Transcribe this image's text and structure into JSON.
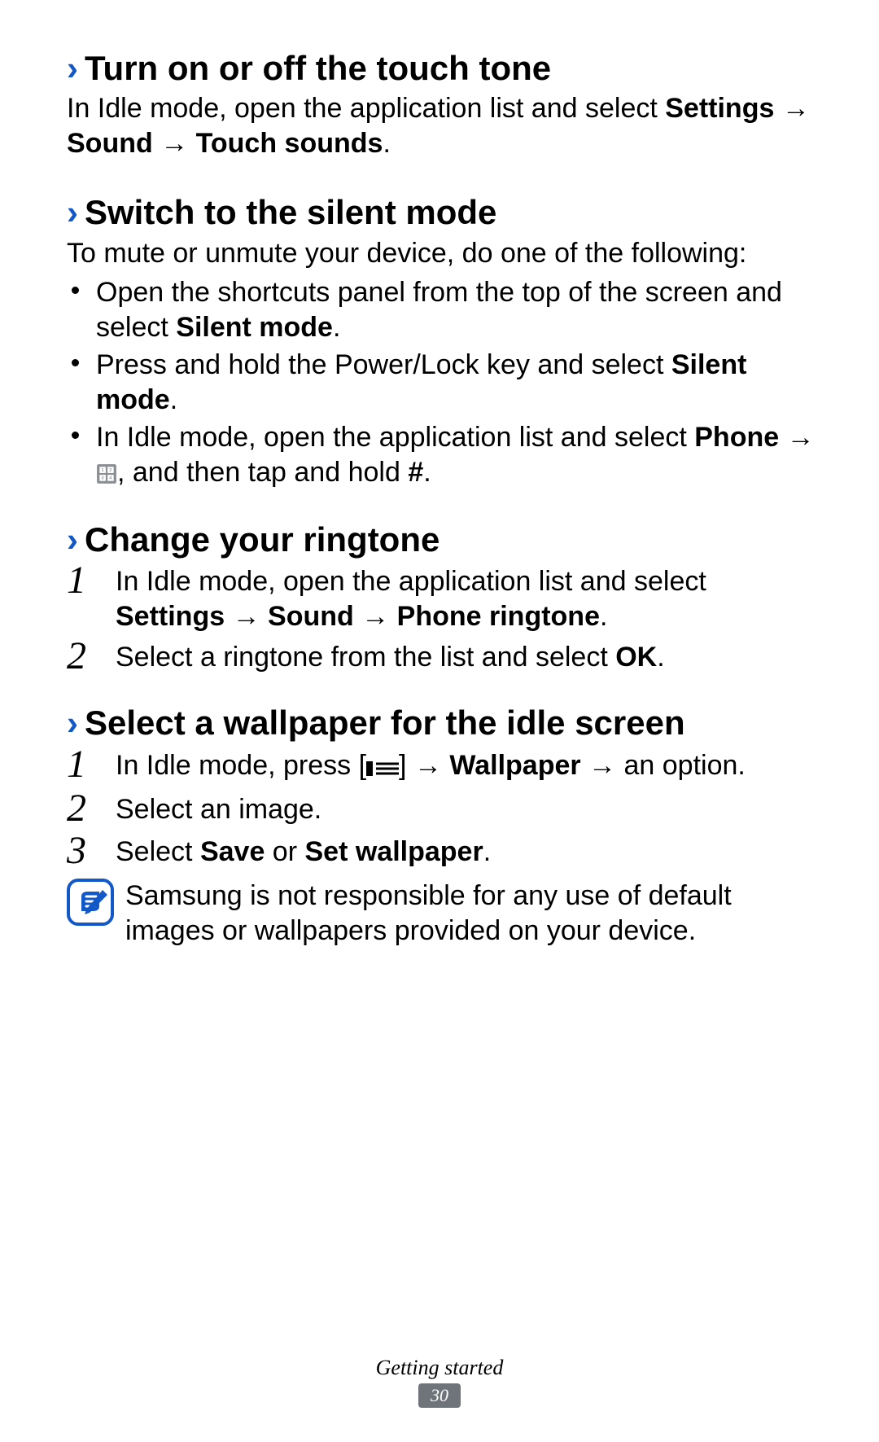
{
  "sections": {
    "touch_tone": {
      "title": "Turn on or off the touch tone",
      "body_pre": "In Idle mode, open the application list and select ",
      "body_bold": "Settings → Sound → Touch sounds",
      "body_post": "."
    },
    "silent": {
      "title": "Switch to the silent mode",
      "intro": "To mute or unmute your device, do one of the following:",
      "bullets": {
        "b1_pre": "Open the shortcuts panel from the top of the screen and select ",
        "b1_bold": "Silent mode",
        "b1_post": ".",
        "b2_pre": "Press and hold the Power/Lock key and select ",
        "b2_bold": "Silent mode",
        "b2_post": ".",
        "b3_pre": "In Idle mode, open the application list and select ",
        "b3_bold": "Phone",
        "b3_mid": " → ",
        "b3_tail_pre": ", and then tap and hold ",
        "b3_tail_bold": "#",
        "b3_tail_post": "."
      }
    },
    "ringtone": {
      "title": "Change your ringtone",
      "steps": {
        "s1_num": "1",
        "s1_pre": "In Idle mode, open the application list and select ",
        "s1_bold": "Settings → Sound → Phone ringtone",
        "s1_post": ".",
        "s2_num": "2",
        "s2_pre": "Select a ringtone from the list and select ",
        "s2_bold": "OK",
        "s2_post": "."
      }
    },
    "wallpaper": {
      "title": "Select a wallpaper for the idle screen",
      "steps": {
        "s1_num": "1",
        "s1_pre": "In Idle mode, press [",
        "s1_mid1": "] → ",
        "s1_bold": "Wallpaper",
        "s1_post": " → an option.",
        "s2_num": "2",
        "s2_text": "Select an image.",
        "s3_num": "3",
        "s3_pre": "Select ",
        "s3_bold1": "Save",
        "s3_mid": " or ",
        "s3_bold2": "Set wallpaper",
        "s3_post": "."
      },
      "note": "Samsung is not responsible for any use of default images or wallpapers provided on your device."
    }
  },
  "footer": {
    "section_label": "Getting started",
    "page_number": "30"
  },
  "icons": {
    "chevron": "chevron-right-icon",
    "keypad": "keypad-icon",
    "menu": "menu-icon",
    "note": "note-icon"
  },
  "colors": {
    "accent": "#1258c9",
    "badge": "#6e7479"
  }
}
